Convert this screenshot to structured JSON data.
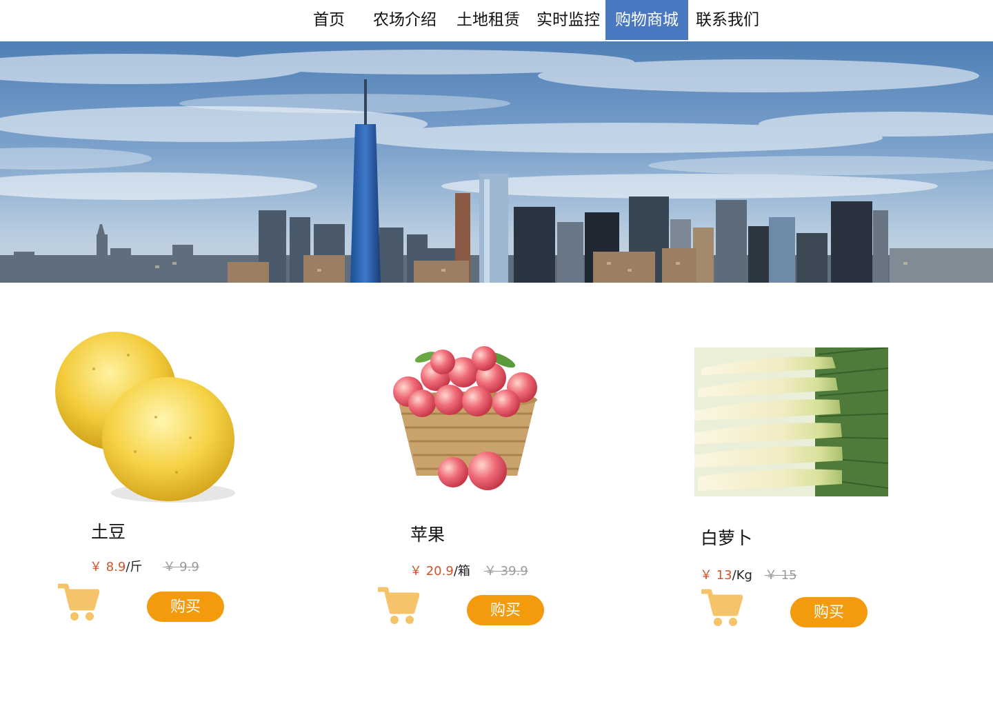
{
  "nav": {
    "items": [
      {
        "label": "首页"
      },
      {
        "label": "农场介绍"
      },
      {
        "label": "土地租赁"
      },
      {
        "label": "实时监控"
      },
      {
        "label": "购物商城",
        "active": true
      },
      {
        "label": "联系我们"
      }
    ]
  },
  "banner": {
    "alt": "city-skyline"
  },
  "products": [
    {
      "name": "土豆",
      "price": "￥ 8.9",
      "unit": "/斤",
      "old_price": "￥ 9.9",
      "buy_label": "购买",
      "image": "potato"
    },
    {
      "name": "苹果",
      "price": "￥ 20.9",
      "unit": "/箱",
      "old_price": "￥ 39.9",
      "buy_label": "购买",
      "image": "apple-basket"
    },
    {
      "name": "白萝卜",
      "price": "￥ 13",
      "unit": "/Kg",
      "old_price": "￥ 15",
      "buy_label": "购买",
      "image": "white-radish"
    }
  ],
  "colors": {
    "nav_active": "#4a78c0",
    "buy_button": "#f39a0d",
    "cart_icon": "#f5c46a",
    "price": "#d2522b",
    "old_price": "#9a9a9a"
  },
  "icons": {
    "cart": "shopping-cart-icon"
  }
}
